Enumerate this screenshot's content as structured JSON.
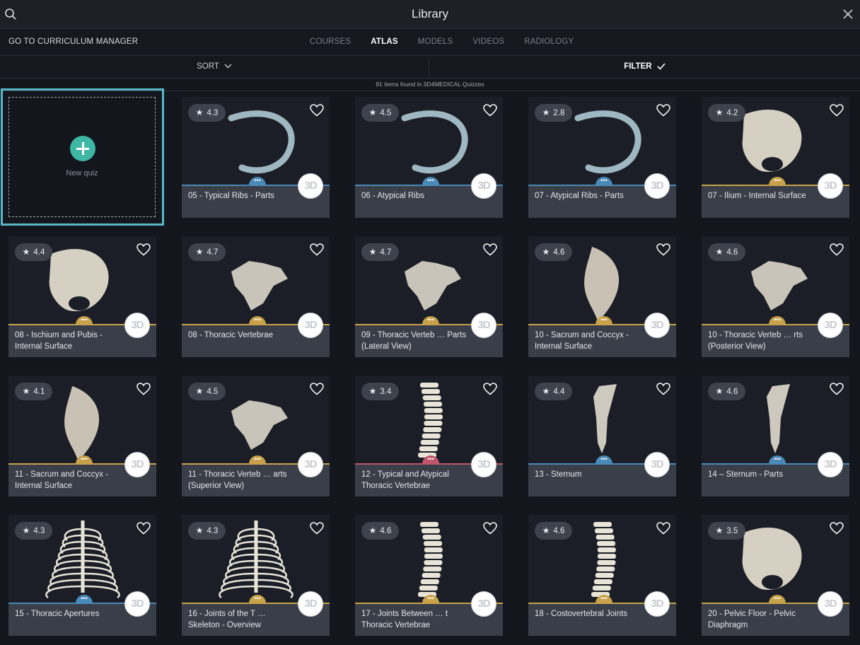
{
  "header": {
    "title": "Library"
  },
  "nav": {
    "curriculum_link": "GO TO CURRICULUM MANAGER",
    "tabs": [
      {
        "label": "COURSES",
        "active": false
      },
      {
        "label": "ATLAS",
        "active": true
      },
      {
        "label": "MODELS",
        "active": false
      },
      {
        "label": "VIDEOS",
        "active": false
      },
      {
        "label": "RADIOLOGY",
        "active": false
      }
    ]
  },
  "toolbar": {
    "sort_label": "SORT",
    "filter_label": "FILTER"
  },
  "results": {
    "count_text": "91 items found in 3D4MEDICAL Quizzes"
  },
  "new_quiz": {
    "label": "New quiz",
    "accent": "#5ab8c6",
    "button_color": "#3fb7a5"
  },
  "items": [
    {
      "rating": "4.3",
      "title": "05 - Typical Ribs - Parts",
      "accent": "#4a8ab8",
      "badge": "3D",
      "icon": "rib-model"
    },
    {
      "rating": "4.5",
      "title": "06 - Atypical Ribs",
      "accent": "#4a8ab8",
      "badge": "3D",
      "icon": "rib-model"
    },
    {
      "rating": "2.8",
      "title": "07 - Atypical Ribs - Parts",
      "accent": "#4a8ab8",
      "badge": "3D",
      "icon": "rib-model"
    },
    {
      "rating": "4.2",
      "title": "07 - Ilium - Internal Surface",
      "accent": "#c8a24a",
      "badge": "3D",
      "icon": "pelvis-model"
    },
    {
      "rating": "4.4",
      "title": "08 - Ischium and Pubis - Internal Surface",
      "accent": "#c8a24a",
      "badge": "3D",
      "icon": "pelvis-model"
    },
    {
      "rating": "4.7",
      "title": "08 - Thoracic Vertebrae",
      "accent": "#c8a24a",
      "badge": "3D",
      "icon": "vertebra-model"
    },
    {
      "rating": "4.7",
      "title": "09 - Thoracic Verteb … Parts (Lateral View)",
      "accent": "#c8a24a",
      "badge": "3D",
      "icon": "vertebra-model"
    },
    {
      "rating": "4.6",
      "title": "10 - Sacrum and Coccyx - Internal Surface",
      "accent": "#c8a24a",
      "badge": "3D",
      "icon": "sacrum-model"
    },
    {
      "rating": "4.6",
      "title": "10 - Thoracic Verteb … rts (Posterior View)",
      "accent": "#c8a24a",
      "badge": "3D",
      "icon": "vertebra-model"
    },
    {
      "rating": "4.1",
      "title": "11 - Sacrum and Coccyx - Internal Surface",
      "accent": "#c8a24a",
      "badge": "3D",
      "icon": "sacrum-model"
    },
    {
      "rating": "4.5",
      "title": "11 - Thoracic Verteb … arts (Superior View)",
      "accent": "#c8a24a",
      "badge": "3D",
      "icon": "vertebra-model"
    },
    {
      "rating": "3.4",
      "title": "12 - Typical and Atypical Thoracic Vertebrae",
      "accent": "#c0566a",
      "badge": "3D",
      "icon": "spine-model"
    },
    {
      "rating": "4.4",
      "title": "13 - Sternum",
      "accent": "#4a8ab8",
      "badge": "3D",
      "icon": "sternum-model"
    },
    {
      "rating": "4.6",
      "title": "14 – Sternum - Parts",
      "accent": "#4a8ab8",
      "badge": "3D",
      "icon": "sternum-model"
    },
    {
      "rating": "4.3",
      "title": "15 - Thoracic Apertures",
      "accent": "#4a8ab8",
      "badge": "3D",
      "icon": "ribcage-model"
    },
    {
      "rating": "4.3",
      "title": "16 - Joints of the T … Skeleton - Overview",
      "accent": "#c8a24a",
      "badge": "3D",
      "icon": "ribcage-model"
    },
    {
      "rating": "4.6",
      "title": "17 - Joints Between … t Thoracic Vertebrae",
      "accent": "#c8a24a",
      "badge": "3D",
      "icon": "spine-model"
    },
    {
      "rating": "4.6",
      "title": "18 - Costovertebral Joints",
      "accent": "#c8a24a",
      "badge": "3D",
      "icon": "spine-model"
    },
    {
      "rating": "3.5",
      "title": "20 - Pelvic Floor - Pelvic Diaphragm",
      "accent": "#c8a24a",
      "badge": "3D",
      "icon": "pelvis-model"
    }
  ]
}
